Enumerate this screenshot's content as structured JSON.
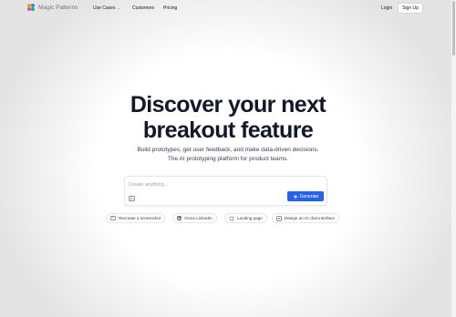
{
  "nav": {
    "logo_text": "Magic Patterns",
    "links": [
      "Use Cases",
      "Customers",
      "Pricing"
    ],
    "login_label": "Login",
    "signup_label": "Sign Up"
  },
  "hero": {
    "headline_line1": "Discover your next",
    "headline_line2": "breakout feature",
    "subtitle_line1": "Build prototypes, get user feedback, and make data-driven decisions.",
    "subtitle_line2": "The AI prototyping platform for product teams."
  },
  "prompt": {
    "placeholder": "Create anything...",
    "value": "",
    "generate_label": "Generate",
    "attach_icon": "image-icon",
    "generate_icon": "sparkle-icon"
  },
  "suggestions": [
    {
      "label": "Recreate a screenshot",
      "icon": "image-icon"
    },
    {
      "label": "Clone LinkedIn",
      "icon": "linkedin-icon"
    },
    {
      "label": "Landing page",
      "icon": "loader-icon"
    },
    {
      "label": "Design an AI chat interface",
      "icon": "chat-icon"
    }
  ],
  "colors": {
    "accent": "#2563eb",
    "text": "#111827",
    "muted": "#374151",
    "border": "#e5e7eb"
  }
}
